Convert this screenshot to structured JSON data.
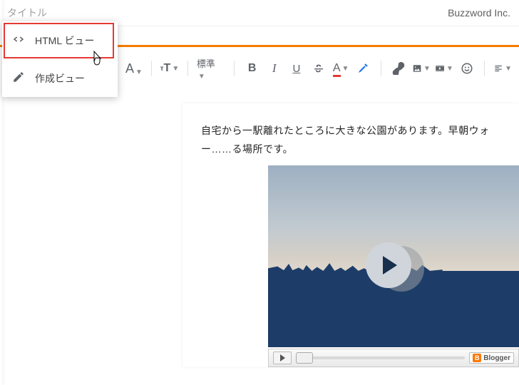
{
  "header": {
    "title_placeholder": "タイトル",
    "brand": "Buzzword Inc."
  },
  "view_menu": [
    {
      "icon": "code-icon",
      "label": "HTML ビュー"
    },
    {
      "icon": "pencil-icon",
      "label": "作成ビュー"
    }
  ],
  "toolbar": {
    "font_letter": "A",
    "size_letters": "тT",
    "paragraph_label": "標準",
    "bold": "B",
    "italic": "I",
    "underline": "U",
    "text_color_letter": "A"
  },
  "content": {
    "paragraph": "自宅から一駅離れたところに大きな公園があります。早朝ウォー……る場所です。"
  },
  "controls": {
    "blogger_label": "Blogger"
  }
}
